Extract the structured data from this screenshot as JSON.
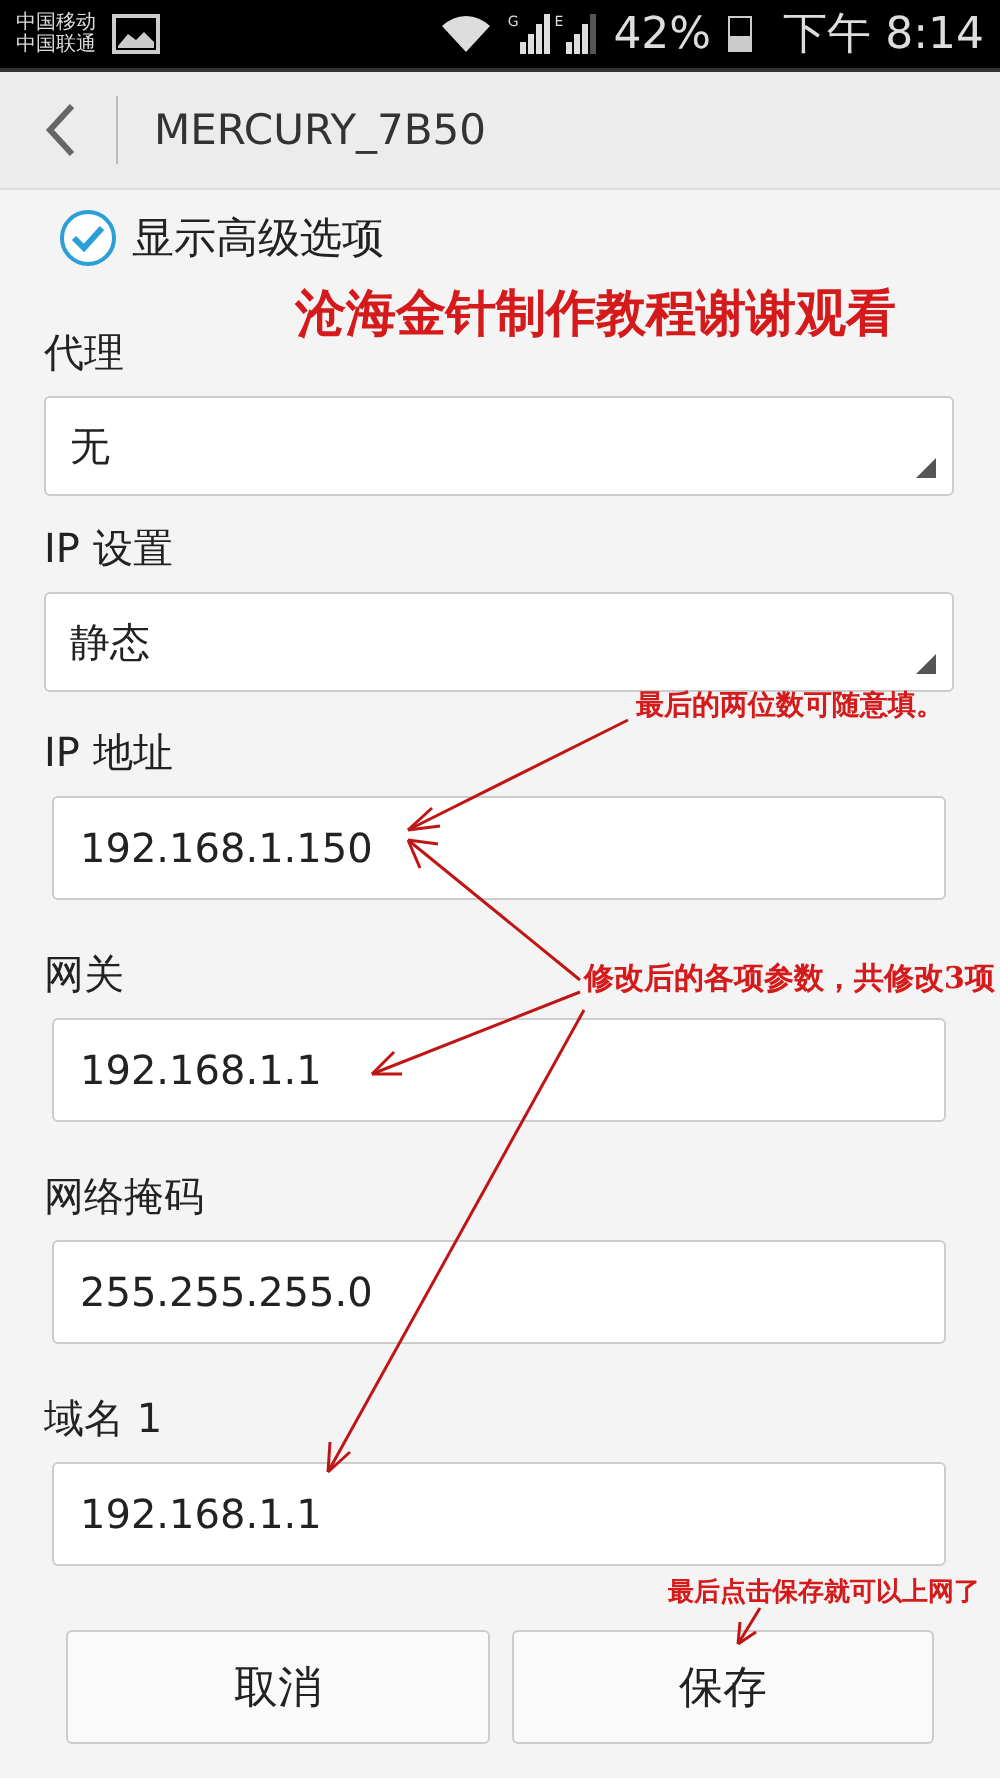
{
  "status_bar": {
    "carriers": [
      "中国移动",
      "中国联通"
    ],
    "network_types": [
      "G",
      "E"
    ],
    "battery": "42%",
    "time": "下午 8:14"
  },
  "header": {
    "title": "MERCURY_7B50"
  },
  "advanced_options": {
    "label": "显示高级选项",
    "checked": true
  },
  "fields": [
    {
      "kind": "dropdown",
      "label": "代理",
      "value": "无"
    },
    {
      "kind": "dropdown",
      "label": "IP 设置",
      "value": "静态"
    },
    {
      "kind": "input",
      "label": "IP 地址",
      "value": "192.168.1.150"
    },
    {
      "kind": "input",
      "label": "网关",
      "value": "192.168.1.1"
    },
    {
      "kind": "input",
      "label": "网络掩码",
      "value": "255.255.255.0"
    },
    {
      "kind": "input",
      "label": "域名 1",
      "value": "192.168.1.1"
    }
  ],
  "buttons": [
    {
      "label": "取消"
    },
    {
      "label": "保存"
    }
  ],
  "annotations": [
    {
      "kind": "title",
      "text": "沧海金针制作教程谢谢观看"
    },
    {
      "kind": "note",
      "text": "最后的两位数可随意填。"
    },
    {
      "kind": "note",
      "text": "修改后的各项参数，共修改3项"
    },
    {
      "kind": "note",
      "text": "最后点击保存就可以上网了"
    }
  ]
}
